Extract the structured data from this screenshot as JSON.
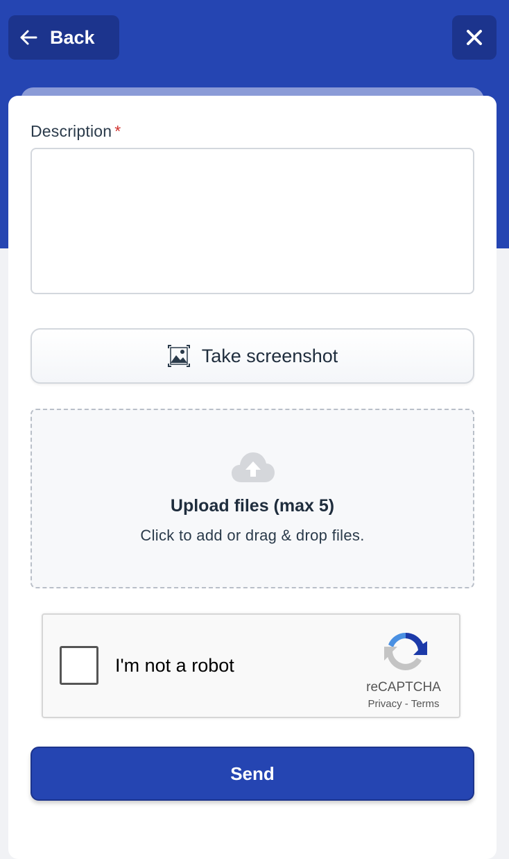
{
  "header": {
    "back_label": "Back",
    "back_icon": "arrow-left-icon",
    "close_icon": "close-icon",
    "accent_color": "#2545b2"
  },
  "form": {
    "description_label": "Description",
    "required_marker": "*",
    "description_value": "",
    "screenshot_label": "Take screenshot",
    "screenshot_icon": "image-screenshot-icon",
    "upload_title": "Upload files (max 5)",
    "upload_subtitle": "Click to add or drag & drop files.",
    "upload_icon": "cloud-upload-icon"
  },
  "recaptcha": {
    "label": "I'm not a robot",
    "checked": false,
    "brand": "reCAPTCHA",
    "privacy": "Privacy",
    "separator": "-",
    "terms": "Terms"
  },
  "submit": {
    "label": "Send"
  }
}
